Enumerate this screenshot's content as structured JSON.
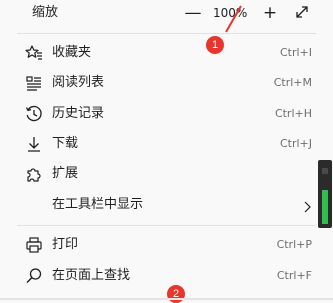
{
  "zoom": {
    "label": "缩放",
    "minus": "—",
    "value": "100%",
    "plus": "+",
    "expand_icon": "expand-diagonal-icon"
  },
  "menu_items": [
    {
      "label": "收藏夹",
      "shortcut": "Ctrl+I",
      "icon": "favorites-star-icon"
    },
    {
      "label": "阅读列表",
      "shortcut": "Ctrl+M",
      "icon": "reading-list-icon"
    },
    {
      "label": "历史记录",
      "shortcut": "Ctrl+H",
      "icon": "history-clock-icon"
    },
    {
      "label": "下载",
      "shortcut": "Ctrl+J",
      "icon": "download-arrow-icon"
    },
    {
      "label": "扩展",
      "shortcut": "",
      "icon": "extensions-puzzle-icon"
    },
    {
      "label": "在工具栏中显示",
      "shortcut": "",
      "icon": "chevron-right-icon"
    },
    {
      "label": "打印",
      "shortcut": "Ctrl+P",
      "icon": "printer-icon"
    },
    {
      "label": "在页面上查找",
      "shortcut": "Ctrl+F",
      "icon": "find-magnifier-icon"
    }
  ],
  "badges": [
    "1",
    "2"
  ],
  "colors": {
    "badge": "#e8362d",
    "menu_background": "#f9f9f9",
    "divider": "#e1e1e1",
    "shortcut_text": "#6e6e6e",
    "widget_green": "#2fbf4f"
  }
}
